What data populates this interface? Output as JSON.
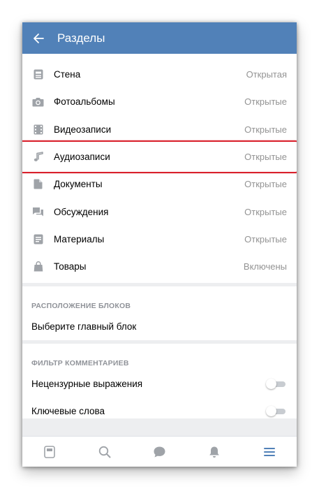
{
  "header": {
    "title": "Разделы",
    "back_icon": "arrow-left-icon"
  },
  "sections": [
    {
      "icon": "wall-icon",
      "label": "Стена",
      "value": "Открытая"
    },
    {
      "icon": "camera-icon",
      "label": "Фотоальбомы",
      "value": "Открытые"
    },
    {
      "icon": "film-icon",
      "label": "Видеозаписи",
      "value": "Открытые"
    },
    {
      "icon": "music-note-icon",
      "label": "Аудиозаписи",
      "value": "Открытые",
      "highlighted": true
    },
    {
      "icon": "document-icon",
      "label": "Документы",
      "value": "Открытые"
    },
    {
      "icon": "discussion-icon",
      "label": "Обсуждения",
      "value": "Открытые"
    },
    {
      "icon": "article-icon",
      "label": "Материалы",
      "value": "Открытые"
    },
    {
      "icon": "shopping-bag-icon",
      "label": "Товары",
      "value": "Включены"
    }
  ],
  "blocks": {
    "title": "РАСПОЛОЖЕНИЕ БЛОКОВ",
    "main_block_label": "Выберите главный блок"
  },
  "comment_filter": {
    "title": "ФИЛЬТР КОММЕНТАРИЕВ",
    "items": [
      {
        "label": "Нецензурные выражения",
        "enabled": false
      },
      {
        "label": "Ключевые слова",
        "enabled": false
      }
    ]
  },
  "tabbar": [
    {
      "icon": "news-icon",
      "active": false
    },
    {
      "icon": "search-icon",
      "active": false
    },
    {
      "icon": "messages-icon",
      "active": false
    },
    {
      "icon": "bell-icon",
      "active": false
    },
    {
      "icon": "menu-icon",
      "active": true
    }
  ],
  "colors": {
    "header": "#5181b8",
    "icon_gray": "#9fa3a8",
    "active_tab": "#5181b8",
    "highlight": "#d9212c"
  }
}
